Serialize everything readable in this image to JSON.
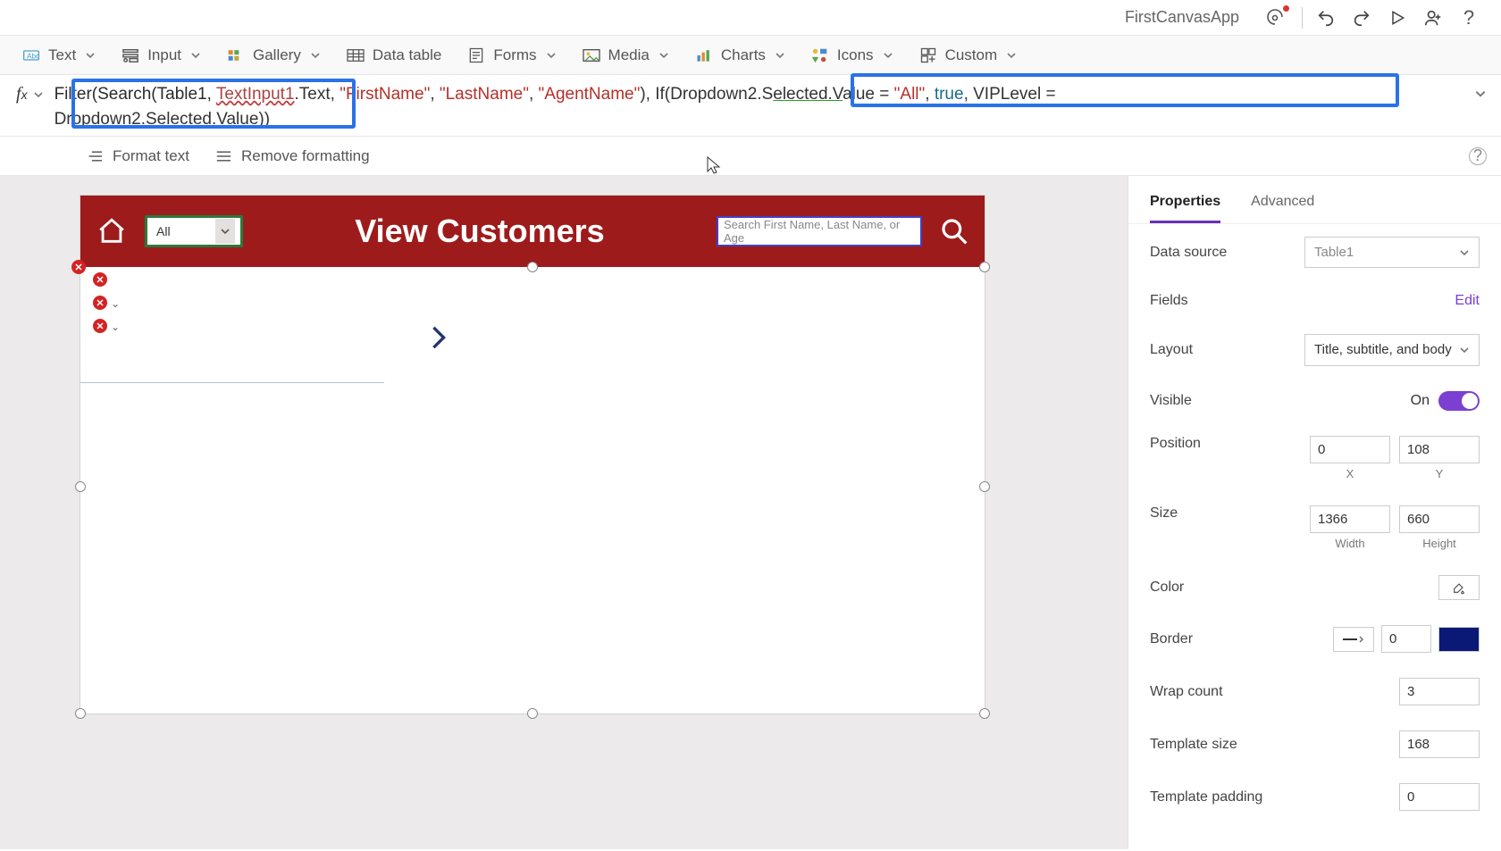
{
  "titlebar": {
    "app_name": "FirstCanvasApp"
  },
  "ribbon": {
    "text": "Text",
    "input": "Input",
    "gallery": "Gallery",
    "data_table": "Data table",
    "forms": "Forms",
    "media": "Media",
    "charts": "Charts",
    "icons": "Icons",
    "custom": "Custom"
  },
  "formula": {
    "line1_pre": "Filter(Search(Table1, ",
    "line1_ti": "TextInput1",
    "line1_mid": ".Text, ",
    "str_first": "\"FirstName\"",
    "str_last": "\"LastName\"",
    "str_agent": "\"AgentName\"",
    "line1_post": "), If(Dropdown2.S",
    "sel": "elected.V",
    "line1_post2": "alue = ",
    "str_all": "\"All\"",
    "line1_post3": ", true, VIPLevel = ",
    "line2": "Dropdown2.Selected.Value))"
  },
  "formatbar": {
    "format": "Format text",
    "remove": "Remove formatting"
  },
  "canvas": {
    "dropdown": "All",
    "title": "View Customers",
    "search_placeholder": "Search First Name, Last Name, or Age"
  },
  "props": {
    "tab_props": "Properties",
    "tab_adv": "Advanced",
    "data_source_label": "Data source",
    "data_source_value": "Table1",
    "fields_label": "Fields",
    "fields_edit": "Edit",
    "layout_label": "Layout",
    "layout_value": "Title, subtitle, and body",
    "visible_label": "Visible",
    "visible_on": "On",
    "position_label": "Position",
    "pos_x": "0",
    "pos_y": "108",
    "pos_x_lbl": "X",
    "pos_y_lbl": "Y",
    "size_label": "Size",
    "size_w": "1366",
    "size_h": "660",
    "size_w_lbl": "Width",
    "size_h_lbl": "Height",
    "color_label": "Color",
    "border_label": "Border",
    "border_width": "0",
    "wrap_label": "Wrap count",
    "wrap_value": "3",
    "template_size_label": "Template size",
    "template_size_value": "168",
    "template_padding_label": "Template padding",
    "template_padding_value": "0"
  }
}
